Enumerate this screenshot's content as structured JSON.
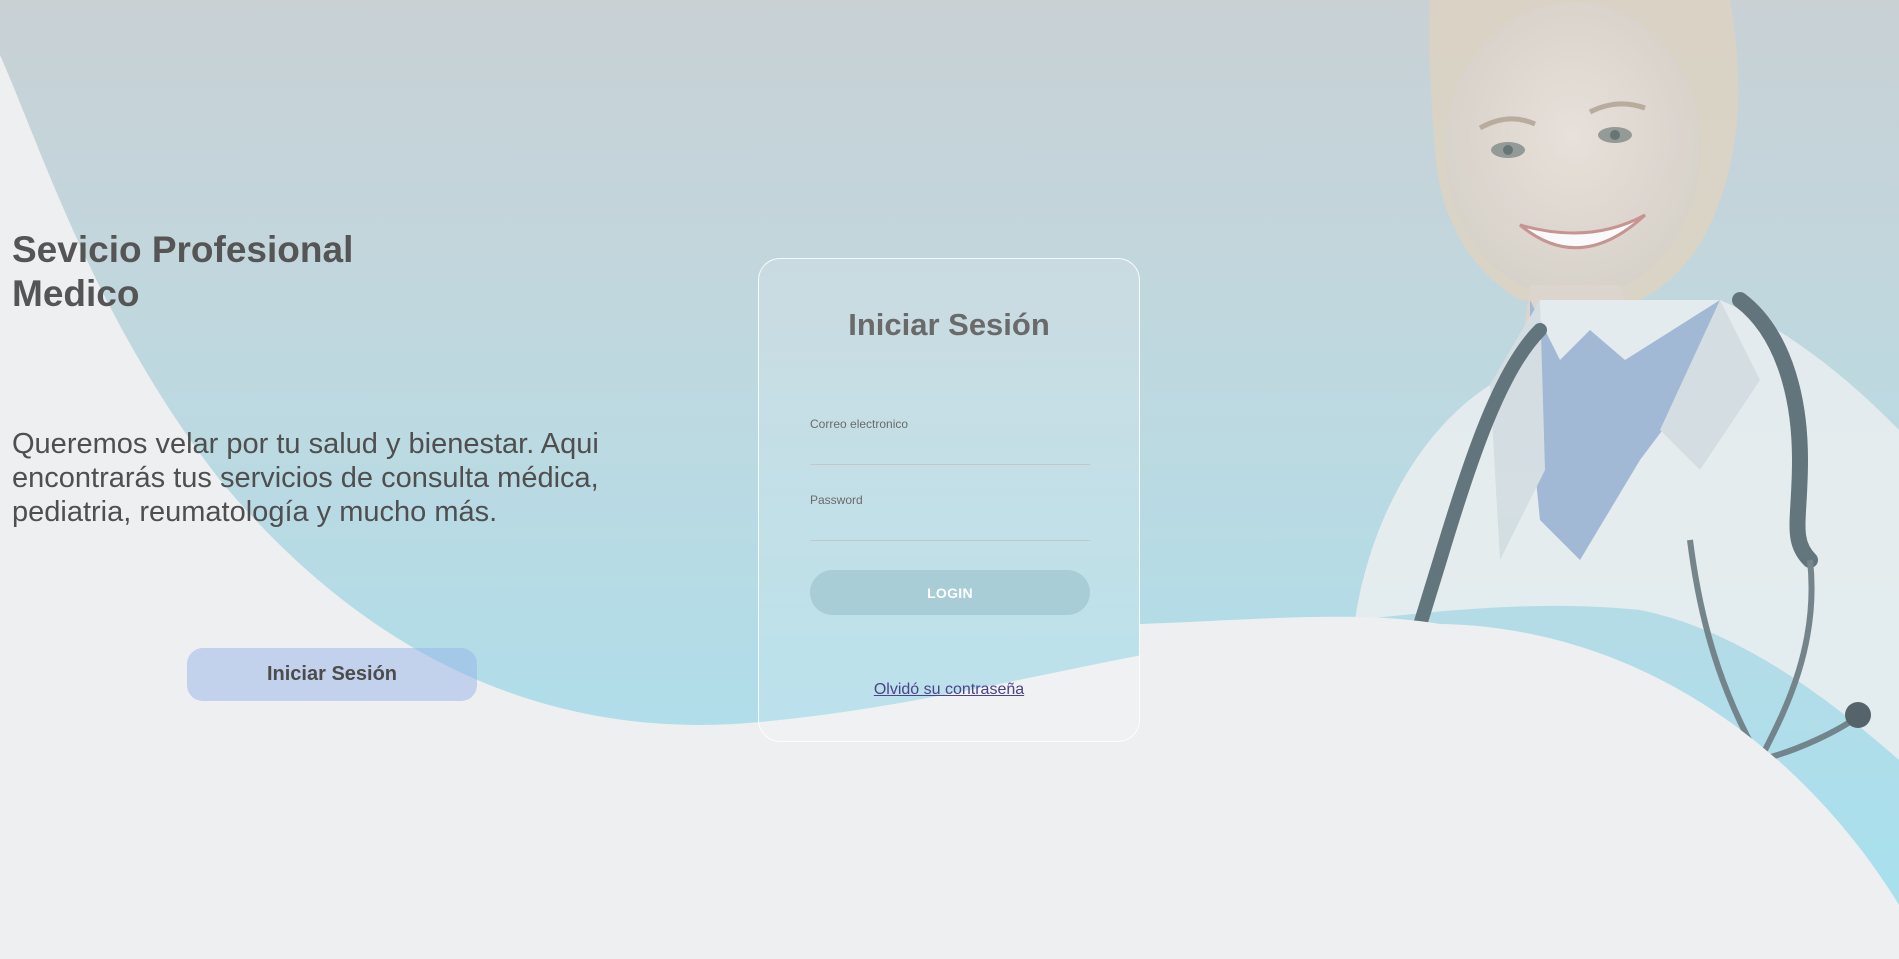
{
  "hero": {
    "title": "Sevicio Profesional Medico",
    "description": "Queremos velar por tu salud y bienestar. Aqui encontrarás tus servicios de consulta médica, pediatria, reumatología y mucho más.",
    "button_label": "Iniciar Sesión"
  },
  "login_card": {
    "title": "Iniciar Sesión",
    "email_label": "Correo electronico",
    "email_value": "",
    "password_label": "Password",
    "password_value": "",
    "login_button_label": "LOGIN",
    "forgot_password_label": "Olvidó su contraseña"
  },
  "colors": {
    "background": "#eeeff1",
    "accent_cyan": "#a6ddec",
    "hero_button": "#c3d1f0",
    "login_button": "#a8cdd6",
    "link": "#4c4389"
  },
  "images": {
    "background_photo": "doctor-photo"
  }
}
